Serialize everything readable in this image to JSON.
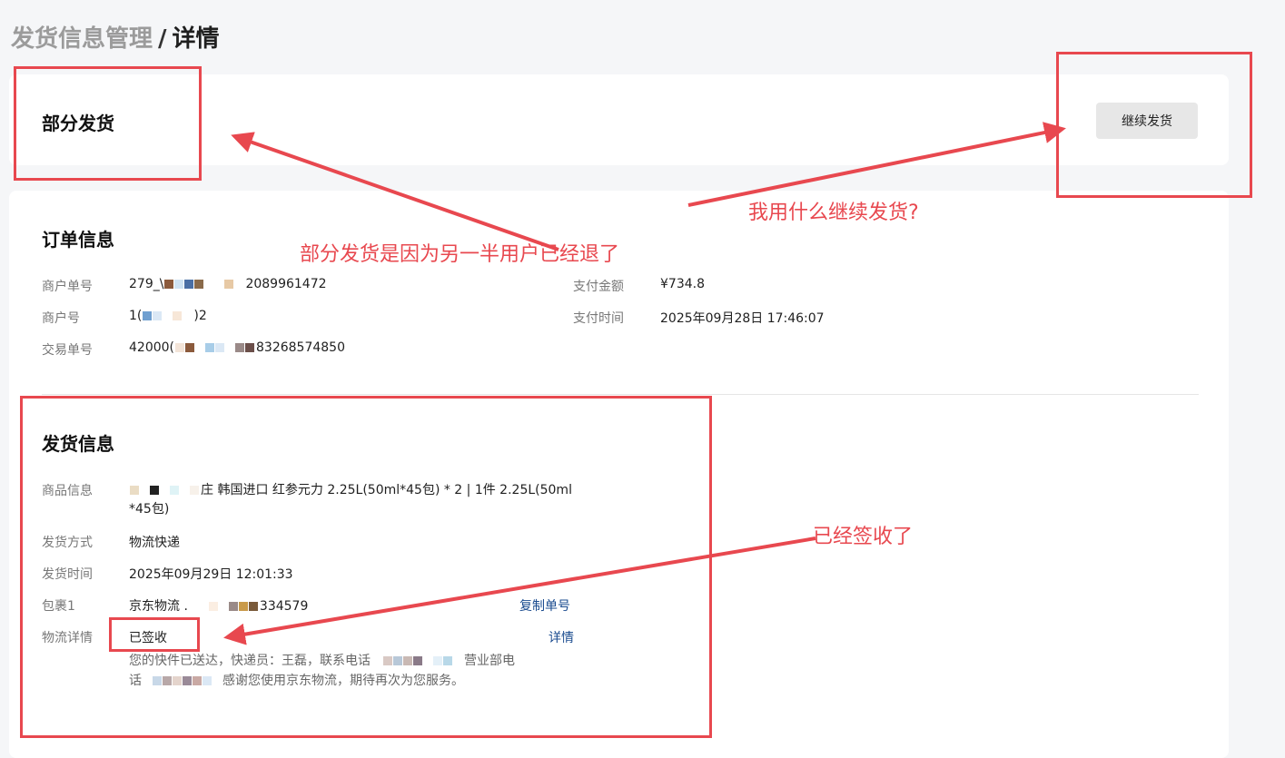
{
  "breadcrumb": {
    "parent": "发货信息管理",
    "separator": "/",
    "current": "详情"
  },
  "status": {
    "title": "部分发货",
    "continue_button": "继续发货"
  },
  "order_info": {
    "title": "订单信息",
    "merchant_order_no": {
      "label": "商户单号",
      "prefix": "279_\\",
      "suffix": "2089961472"
    },
    "merchant_no": {
      "label": "商户号",
      "prefix": "1(",
      "suffix": ")2"
    },
    "trade_no": {
      "label": "交易单号",
      "prefix": "42000(",
      "suffix": "83268574850"
    },
    "pay_amount": {
      "label": "支付金额",
      "value": "¥734.8"
    },
    "pay_time": {
      "label": "支付时间",
      "value": "2025年09月28日 17:46:07"
    }
  },
  "shipping_info": {
    "title": "发货信息",
    "product": {
      "label": "商品信息",
      "line1": "庄 韩国进口 红参元力 2.25L(50ml*45包) * 2 | 1件 2.25L(50ml",
      "line2": "*45包)"
    },
    "method": {
      "label": "发货方式",
      "value": "物流快递"
    },
    "ship_time": {
      "label": "发货时间",
      "value": "2025年09月29日 12:01:33"
    },
    "package": {
      "label": "包裹1",
      "carrier": "京东物流 .",
      "suffix": "334579",
      "copy_link": "复制单号"
    },
    "logistics": {
      "label": "物流详情",
      "status": "已签收",
      "detail_link": "详情",
      "desc_line1_a": "您的快件已送达，快递员：王磊，联系电话",
      "desc_line1_b": "营业部电",
      "desc_line2_a": "话",
      "desc_line2_b": "感谢您使用京东物流，期待再次为您服务。"
    }
  },
  "annotations": {
    "partial_reason": "部分发货是因为另一半用户已经退了",
    "continue_question": "我用什么继续发货?",
    "signed": "已经签收了",
    "color": "#e8484f"
  },
  "colors": {
    "link": "#1a4b8f",
    "background": "#f5f6f8",
    "button_bg": "#e7e7e7"
  }
}
